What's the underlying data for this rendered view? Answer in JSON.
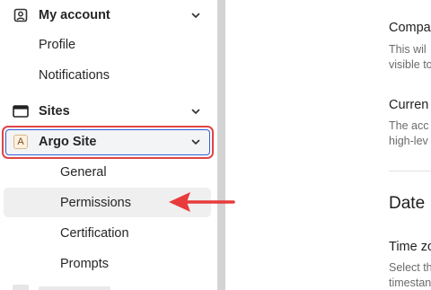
{
  "sidebar": {
    "my_account": {
      "label": "My account",
      "icon": "user-square-icon"
    },
    "profile": {
      "label": "Profile"
    },
    "notifications": {
      "label": "Notifications"
    },
    "sites": {
      "label": "Sites",
      "icon": "browser-window-icon"
    },
    "argo_site": {
      "label": "Argo Site",
      "badge_letter": "A"
    },
    "general": {
      "label": "General"
    },
    "permissions": {
      "label": "Permissions"
    },
    "certification": {
      "label": "Certification"
    },
    "prompts": {
      "label": "Prompts"
    }
  },
  "main": {
    "company_title": "Compa",
    "company_desc_1": "This wil",
    "company_desc_2": "visible to",
    "current_title": "Curren",
    "current_desc_1": "The acc",
    "current_desc_2": "high-lev",
    "date_heading": "Date",
    "timezone_title": "Time zo",
    "timezone_desc_1": "Select th",
    "timezone_desc_2": "timestan"
  },
  "colors": {
    "selection_outline": "#e04545",
    "focus_ring": "#2f5bd6",
    "arrow": "#e83b3b",
    "hover_bg": "#efefef"
  }
}
